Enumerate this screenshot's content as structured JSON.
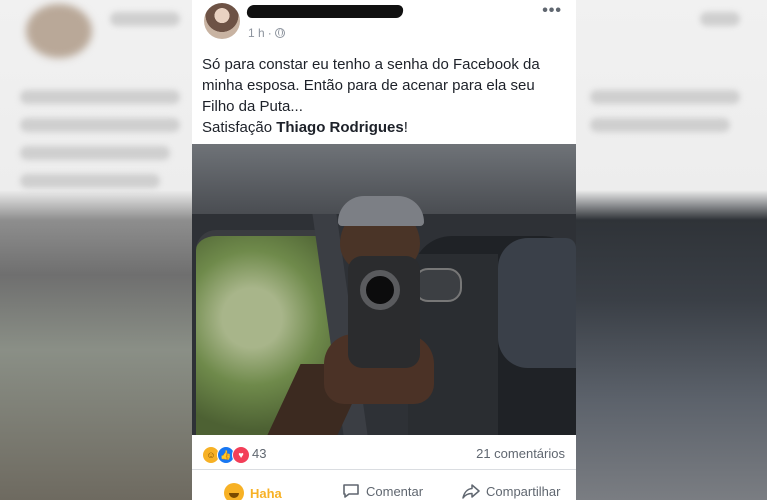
{
  "post": {
    "time": "1 h",
    "separator": "·",
    "more": "•••",
    "text_line1": "Só para constar eu tenho a senha do Facebook da minha esposa. Então para de acenar para ela seu Filho da Puta...",
    "text_prefix": "Satisfação ",
    "text_tag": "Thiago Rodrigues",
    "text_suffix": "!"
  },
  "reactions": {
    "count": "43",
    "comments": "21 comentários",
    "icons": [
      "haha-icon",
      "like-icon",
      "love-icon"
    ]
  },
  "actions": {
    "haha": "Haha",
    "comment": "Comentar",
    "share": "Compartilhar"
  },
  "colors": {
    "accent_haha": "#f7b125",
    "like": "#1877f2",
    "love": "#f33e58",
    "secondary_text": "#606770"
  }
}
